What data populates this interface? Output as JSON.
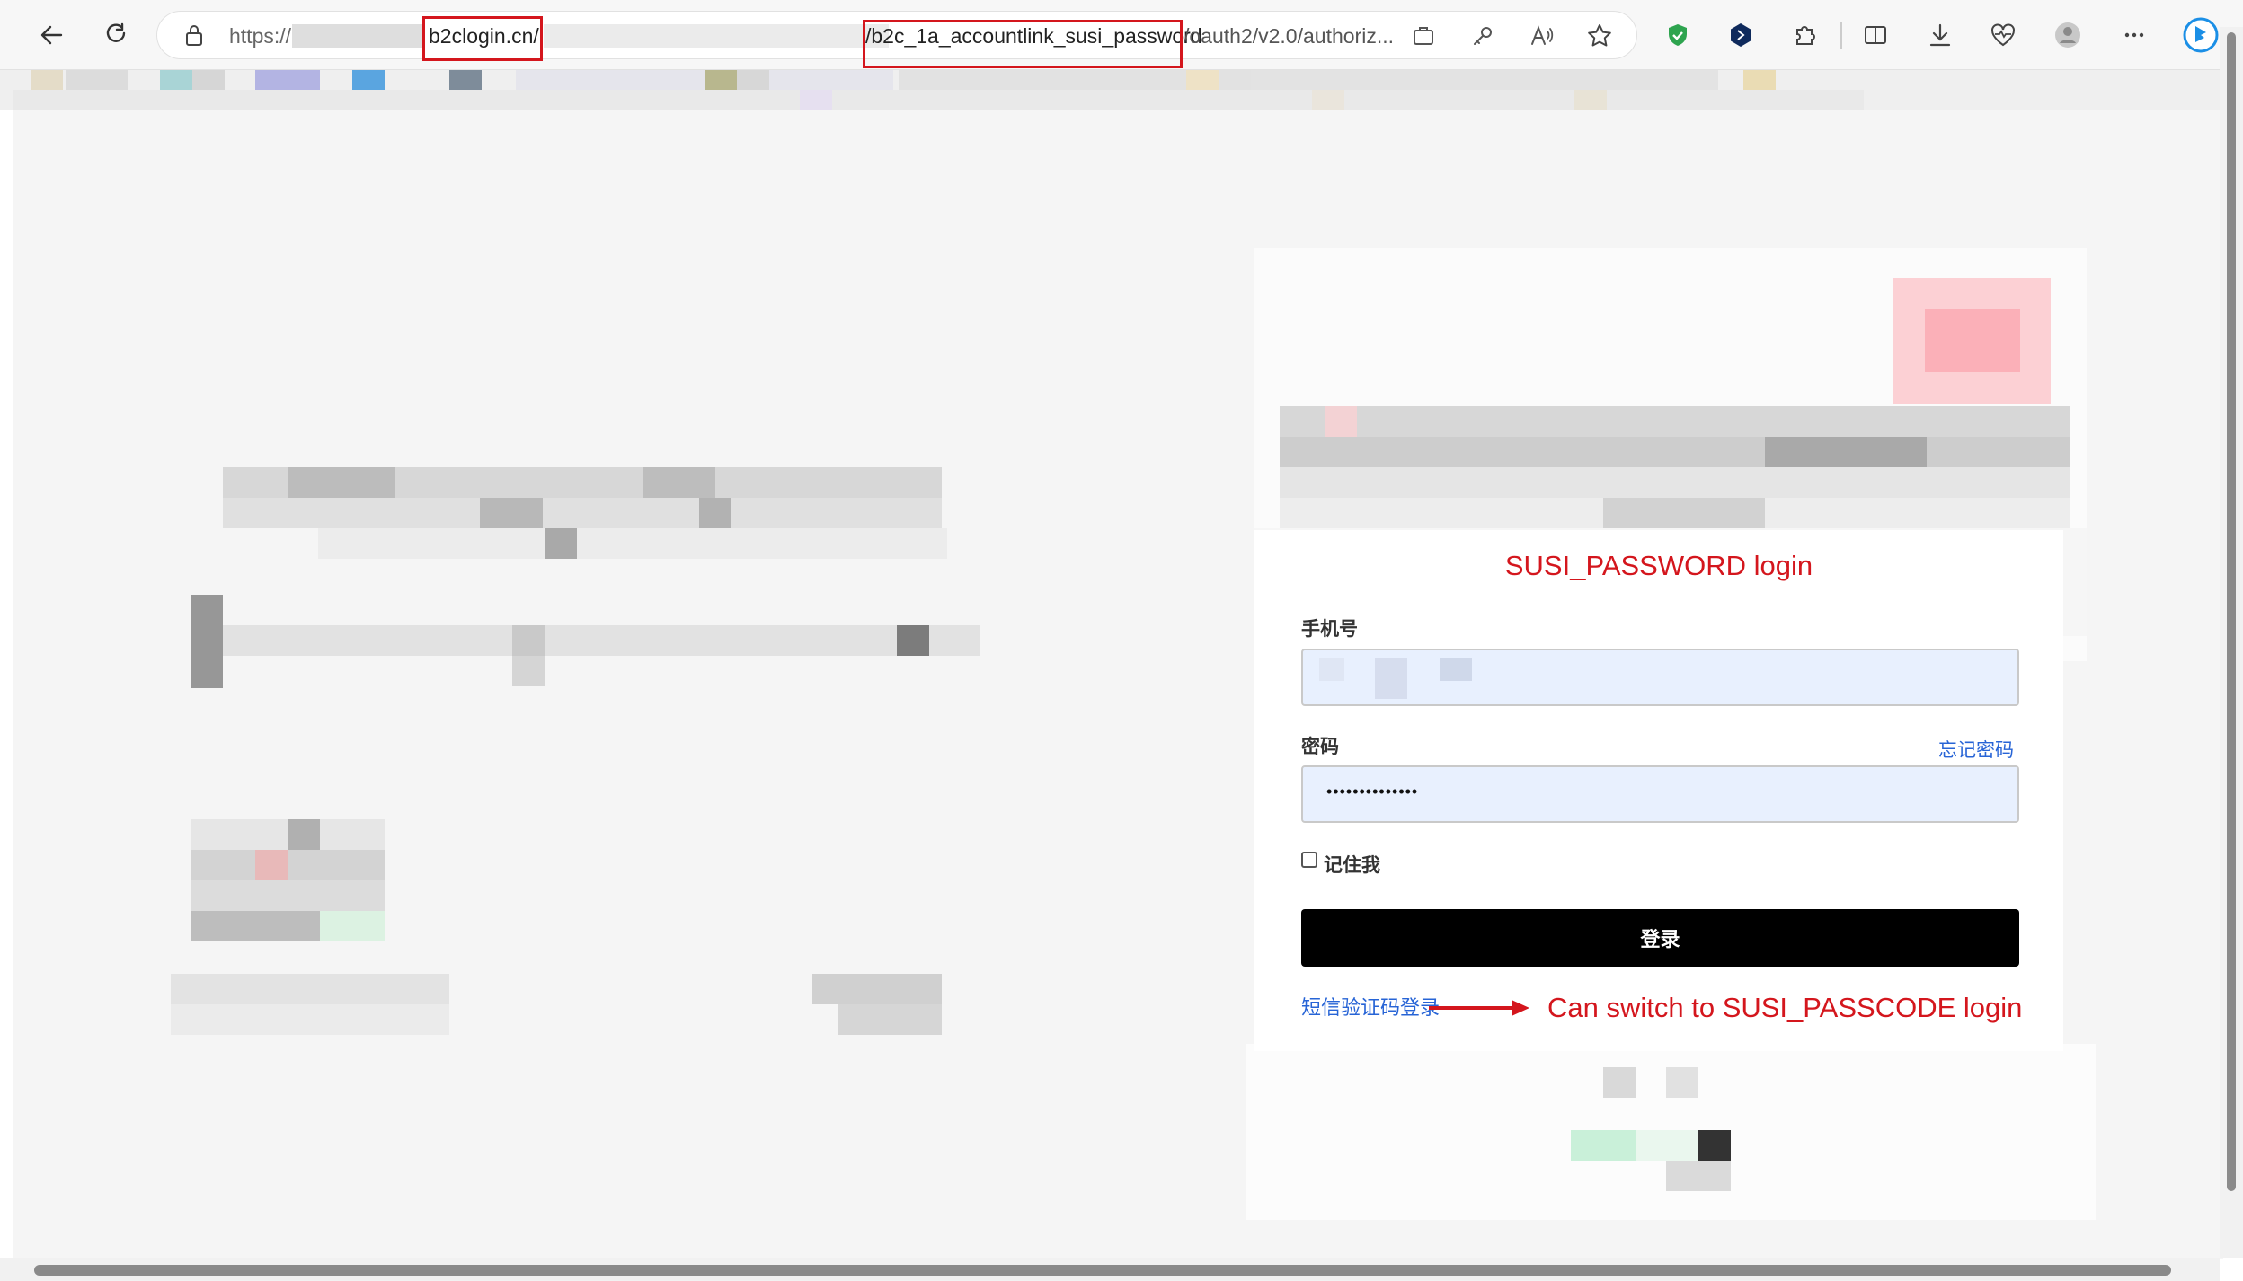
{
  "browser": {
    "url_scheme": "https://",
    "url_domain": "b2clogin.cn/",
    "url_policy": "/b2c_1a_accountlink_susi_password",
    "url_rest": "/oauth2/v2.0/authoriz..."
  },
  "annotations": {
    "title": "SUSI_PASSWORD login",
    "switch_note": "Can switch to SUSI_PASSCODE login",
    "color": "#d4161d"
  },
  "form": {
    "phone_label": "手机号",
    "password_label": "密码",
    "forgot_link": "忘记密码",
    "password_value": "••••••••••••••",
    "remember_label": "记住我",
    "login_button": "登录",
    "sms_link": "短信验证码登录"
  },
  "icons": {
    "back": "back-arrow-icon",
    "refresh": "refresh-icon",
    "lock": "lock-icon",
    "star": "star-icon",
    "more": "more-icon"
  }
}
